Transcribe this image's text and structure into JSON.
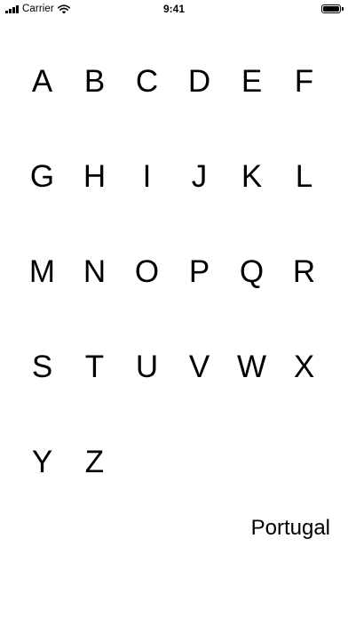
{
  "status_bar": {
    "carrier": "Carrier",
    "time": "9:41",
    "icons": [
      "signal-icon",
      "wifi-icon",
      "battery-icon"
    ]
  },
  "letters": [
    "A",
    "B",
    "C",
    "D",
    "E",
    "F",
    "G",
    "H",
    "I",
    "J",
    "K",
    "L",
    "M",
    "N",
    "O",
    "P",
    "Q",
    "R",
    "S",
    "T",
    "U",
    "V",
    "W",
    "X",
    "Y",
    "Z"
  ],
  "footer": {
    "country": "Portugal"
  }
}
